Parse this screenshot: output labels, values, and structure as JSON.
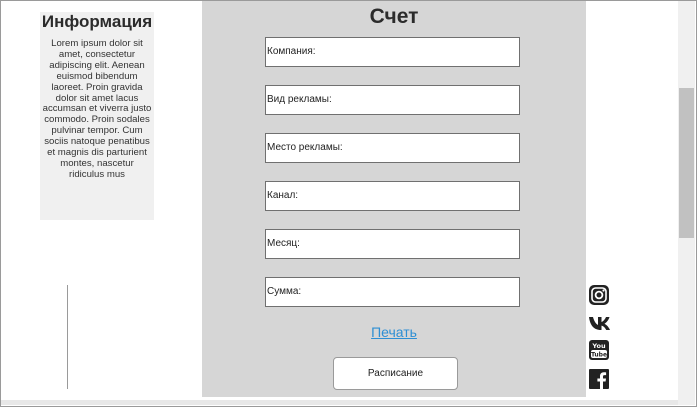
{
  "info": {
    "title": "Информация",
    "text": "Lorem ipsum dolor sit amet, consectetur adipiscing elit. Aenean euismod bibendum laoreet. Proin gravida dolor sit amet lacus accumsan et viverra justo commodo. Proin sodales pulvinar tempor. Cum sociis natoque penatibus et magnis dis parturient montes, nascetur ridiculus mus"
  },
  "form": {
    "title": "Счет",
    "fields": [
      {
        "label": "Компания:"
      },
      {
        "label": "Вид рекламы:"
      },
      {
        "label": "Место рекламы:"
      },
      {
        "label": "Канал:"
      },
      {
        "label": "Месяц:"
      },
      {
        "label": "Сумма:"
      }
    ],
    "print_link": "Печать",
    "schedule_button": "Расписание"
  },
  "social": [
    {
      "icon": "instagram-icon"
    },
    {
      "icon": "vk-icon"
    },
    {
      "icon": "youtube-icon"
    },
    {
      "icon": "facebook-icon"
    }
  ]
}
